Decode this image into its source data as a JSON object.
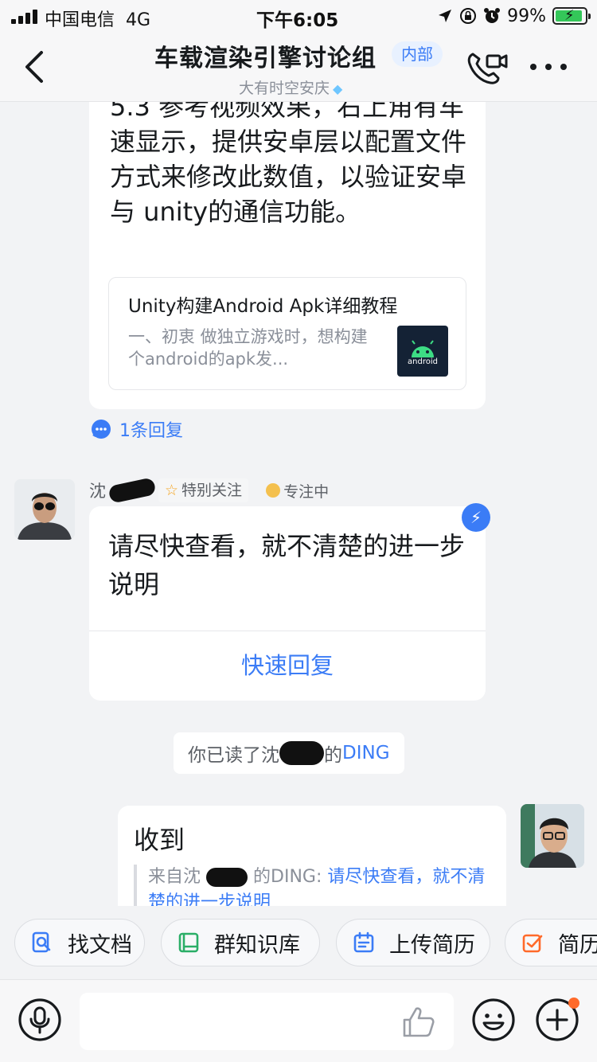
{
  "status_bar": {
    "carrier": "中国电信",
    "network": "4G",
    "time": "下午6:05",
    "battery_percent": "99%",
    "battery_level": 0.99
  },
  "nav": {
    "title": "车载渲染引擎讨论组",
    "tag": "内部",
    "subtitle": "大有时空安庆",
    "icons": [
      "back-icon",
      "video-call-icon",
      "more-icon"
    ]
  },
  "messages": {
    "first": {
      "text": "5.3 参考视频效果，右上角有车速显示，提供安卓层以配置文件方式来修改此数值，以验证安卓与 unity的通信功能。",
      "link_card": {
        "title": "Unity构建Android Apk详细教程",
        "desc": "一、初衷 做独立游戏时，想构建个android的apk发...",
        "thumb_label": "android"
      },
      "reply_count": "1条回复"
    },
    "ding": {
      "sender": "沈",
      "special_tag": "特别关注",
      "status": "专注中",
      "text": "请尽快查看，就不清楚的进一步说明",
      "quick_reply": "快速回复",
      "badge_icon": "lightning-icon"
    },
    "notice": {
      "prefix": "你已读了沈",
      "suffix": "的",
      "ding_word": "DING"
    },
    "mine": {
      "text": "收到",
      "quote_prefix": "来自沈",
      "quote_mid": "的DING:",
      "quote_link": "请尽快查看，就不清楚的进一步说明"
    }
  },
  "tools": [
    {
      "label": "找文档",
      "icon": "doc-search-icon",
      "color": "#3b7cf6"
    },
    {
      "label": "群知识库",
      "icon": "book-icon",
      "color": "#2aae67"
    },
    {
      "label": "上传简历",
      "icon": "calendar-icon",
      "color": "#3b7cf6"
    },
    {
      "label": "简历",
      "icon": "checkbox-icon",
      "color": "#ff6a2a"
    }
  ],
  "input": {
    "placeholder": ""
  },
  "colors": {
    "accent": "#3b7cf6",
    "background": "#f2f3f5"
  }
}
